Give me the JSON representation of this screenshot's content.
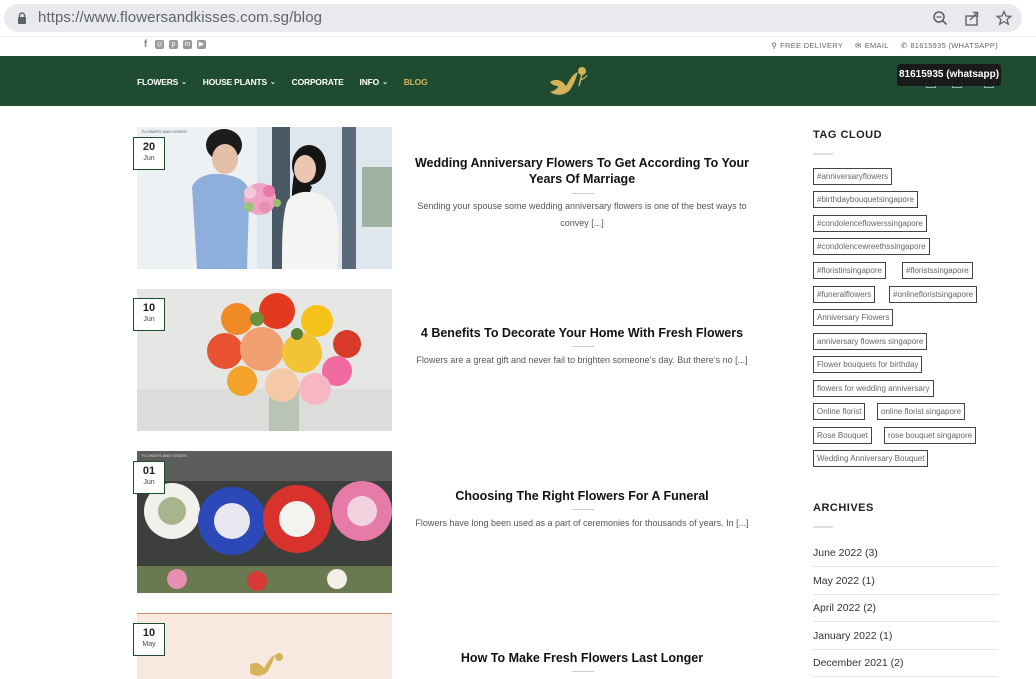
{
  "browser": {
    "url_host": "https://www.flowersandkisses.com.sg",
    "url_path": "/blog"
  },
  "top_bar": {
    "free_delivery": "FREE DELIVERY",
    "email": "EMAIL",
    "whatsapp": "81615935 (WHATSAPP)"
  },
  "nav": {
    "items": [
      {
        "label": "FLOWERS"
      },
      {
        "label": "HOUSE PLANTS"
      },
      {
        "label": "CORPORATE"
      },
      {
        "label": "INFO"
      },
      {
        "label": "BLOG"
      }
    ]
  },
  "tooltip": "81615935 (whatsapp)",
  "posts": [
    {
      "day": "20",
      "month": "Jun",
      "title": "Wedding Anniversary Flowers To Get According To Your Years Of Marriage",
      "excerpt": "Sending your spouse some wedding anniversary flowers is one of the best ways to convey [...]",
      "image_caption": "FLOWERS AND KISSES"
    },
    {
      "day": "10",
      "month": "Jun",
      "title": "4 Benefits To Decorate Your Home With Fresh Flowers",
      "excerpt": "Flowers are a great gift and never fail to brighten someone’s day. But there’s no [...]"
    },
    {
      "day": "01",
      "month": "Jun",
      "title": "Choosing The Right Flowers For A Funeral",
      "excerpt": "Flowers have long been used as a part of ceremonies for thousands of years. In [...]",
      "image_caption": "FLOWERS AND KISSES"
    },
    {
      "day": "10",
      "month": "May",
      "title": "How To Make Fresh Flowers Last Longer",
      "excerpt": ""
    }
  ],
  "sidebar": {
    "tag_cloud_heading": "TAG CLOUD",
    "tags": [
      "#anniversaryflowers",
      "#birthdaybouquetsingapore",
      "#condolenceflowerssingapore",
      "#condolencewreethssingapore",
      "#floristinsingapore",
      "#floristssingapore",
      "#funeralflowers",
      "#onlinefloristsingapore",
      "Anniversary Flowers",
      "anniversary flowers singapore",
      "Flower bouquets for birthday",
      "flowers for wedding anniversary",
      "Online florist",
      "online florist singapore",
      "Rose Bouquet",
      "rose bouquet singapore",
      "Wedding Anniversary Bouquet"
    ],
    "archives_heading": "ARCHIVES",
    "archives": [
      "June 2022 (3)",
      "May 2022 (1)",
      "April 2022 (2)",
      "January 2022 (1)",
      "December 2021 (2)"
    ]
  },
  "colors": {
    "header_green": "#1f4b30",
    "accent_gold": "#d4b45a"
  }
}
